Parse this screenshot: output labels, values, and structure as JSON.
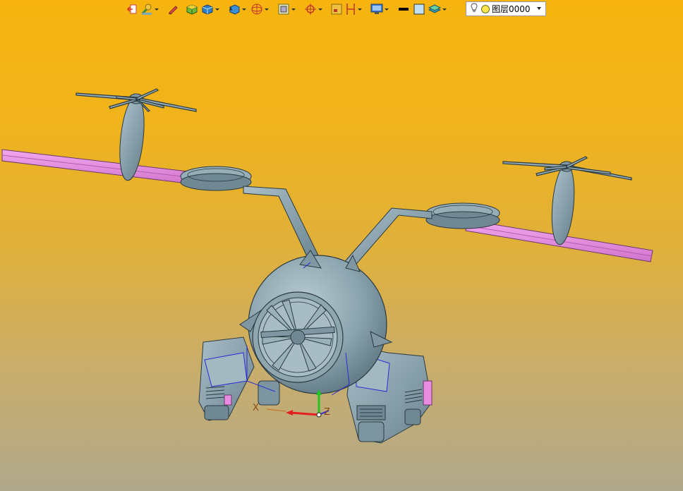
{
  "toolbar": {
    "buttons": [
      {
        "icon": "exit-icon",
        "dropdown": false
      },
      {
        "icon": "paint-brush-icon",
        "dropdown": true
      },
      {
        "icon": "pencil-icon",
        "dropdown": false
      },
      {
        "icon": "shaded-box-icon",
        "dropdown": false
      },
      {
        "icon": "solid-box-icon",
        "dropdown": true
      },
      {
        "icon": "view-orientation-icon",
        "dropdown": true
      },
      {
        "icon": "wireframe-sphere-icon",
        "dropdown": true
      },
      {
        "icon": "render-frame-icon",
        "dropdown": true
      },
      {
        "icon": "snap-target-icon",
        "dropdown": true
      },
      {
        "icon": "section-icon",
        "dropdown": false
      },
      {
        "icon": "measure-icon",
        "dropdown": true
      },
      {
        "icon": "display-settings-icon",
        "dropdown": true
      },
      {
        "icon": "line-color-icon",
        "dropdown": false
      },
      {
        "icon": "fill-color-icon",
        "dropdown": false
      },
      {
        "icon": "layer-stack-icon",
        "dropdown": true
      }
    ]
  },
  "layer": {
    "name": "图层0000",
    "icon": "bulb-icon",
    "color": "#ffe84a"
  },
  "axes": {
    "x_label": "X",
    "z_label": "Z"
  },
  "colors": {
    "background_top": "#f7b40f",
    "background_bottom": "#b1a98d",
    "model_body": "#8da5b0",
    "arm_highlight": "#e98be0",
    "edge_blue": "#2b2bd6"
  }
}
